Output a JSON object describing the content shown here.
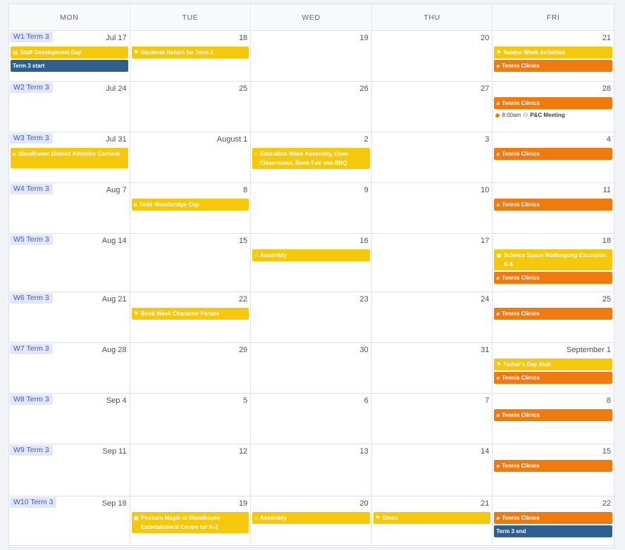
{
  "days_of_week": [
    "MON",
    "TUE",
    "WED",
    "THU",
    "FRI"
  ],
  "colors": {
    "yellow": "#f6c80c",
    "orange": "#f07a0d",
    "blue": "#2f5f8f",
    "week_label": "#e3e7fb"
  },
  "weeks": [
    {
      "label": "W1 Term 3",
      "days": [
        {
          "date": "Jul 17",
          "events": [
            {
              "title": "Staff Development Day",
              "color": "yellow",
              "icon": "clipboard-icon"
            },
            {
              "title": "Term 3 start",
              "color": "blue"
            }
          ]
        },
        {
          "date": "18",
          "events": [
            {
              "title": "Students Return for Term 3",
              "color": "yellow",
              "icon": "bell-icon"
            }
          ]
        },
        {
          "date": "19",
          "events": []
        },
        {
          "date": "20",
          "events": []
        },
        {
          "date": "21",
          "events": [
            {
              "title": "Naidoc Week Activities",
              "color": "yellow",
              "icon": "bell-icon"
            },
            {
              "title": "Tennis Clinics",
              "color": "orange",
              "icon": "racket-icon"
            }
          ]
        }
      ]
    },
    {
      "label": "W2 Term 3",
      "days": [
        {
          "date": "Jul 24",
          "events": []
        },
        {
          "date": "25",
          "events": []
        },
        {
          "date": "26",
          "events": []
        },
        {
          "date": "27",
          "events": []
        },
        {
          "date": "28",
          "events": [
            {
              "title": "Tennis Clinics",
              "color": "orange",
              "icon": "racket-icon"
            },
            {
              "time": "8:00am",
              "title": "P&C Meeting",
              "type": "timed",
              "icon": "people-icon"
            }
          ]
        }
      ]
    },
    {
      "label": "W3 Term 3",
      "days": [
        {
          "date": "Jul 31",
          "events": [
            {
              "title": "Shoalhaven District Athletics Carnival",
              "color": "yellow",
              "icon": "racket-icon",
              "tall": true
            }
          ]
        },
        {
          "date": "August 1",
          "events": []
        },
        {
          "date": "2",
          "events": [
            {
              "title": "Education Week Assembly, Open Classrooms, Book Fair and BBQ",
              "color": "yellow",
              "icon": "school-icon",
              "tall": true
            }
          ]
        },
        {
          "date": "3",
          "events": []
        },
        {
          "date": "4",
          "events": [
            {
              "title": "Tennis Clinics",
              "color": "orange",
              "icon": "racket-icon"
            }
          ]
        }
      ]
    },
    {
      "label": "W4 Term 3",
      "days": [
        {
          "date": "Aug 7",
          "events": []
        },
        {
          "date": "8",
          "events": [
            {
              "title": "Todd Woodbridge Cup",
              "color": "yellow",
              "icon": "racket-icon"
            }
          ]
        },
        {
          "date": "9",
          "events": []
        },
        {
          "date": "10",
          "events": []
        },
        {
          "date": "11",
          "events": [
            {
              "title": "Tennis Clinics",
              "color": "orange",
              "icon": "racket-icon"
            }
          ]
        }
      ]
    },
    {
      "label": "W5 Term 3",
      "days": [
        {
          "date": "Aug 14",
          "events": []
        },
        {
          "date": "15",
          "events": []
        },
        {
          "date": "16",
          "events": [
            {
              "title": "Assembly",
              "color": "yellow",
              "icon": "school-icon"
            }
          ]
        },
        {
          "date": "17",
          "events": []
        },
        {
          "date": "18",
          "events": [
            {
              "title": "Science Space Wollongong Excursion K-6",
              "color": "yellow",
              "icon": "bus-icon",
              "tall": true
            },
            {
              "title": "Tennis Clinics",
              "color": "orange",
              "icon": "racket-icon"
            }
          ]
        }
      ]
    },
    {
      "label": "W6 Term 3",
      "days": [
        {
          "date": "Aug 21",
          "events": []
        },
        {
          "date": "22",
          "events": [
            {
              "title": "Book Week Character Parade",
              "color": "yellow",
              "icon": "bell-icon"
            }
          ]
        },
        {
          "date": "23",
          "events": []
        },
        {
          "date": "24",
          "events": []
        },
        {
          "date": "25",
          "events": [
            {
              "title": "Tennis Clinics",
              "color": "orange",
              "icon": "racket-icon"
            }
          ]
        }
      ]
    },
    {
      "label": "W7 Term 3",
      "days": [
        {
          "date": "Aug 28",
          "events": []
        },
        {
          "date": "29",
          "events": []
        },
        {
          "date": "30",
          "events": []
        },
        {
          "date": "31",
          "events": []
        },
        {
          "date": "September 1",
          "events": [
            {
              "title": "Father's Day Stall",
              "color": "yellow",
              "icon": "bell-icon"
            },
            {
              "title": "Tennis Clinics",
              "color": "orange",
              "icon": "racket-icon"
            }
          ]
        }
      ]
    },
    {
      "label": "W8 Term 3",
      "days": [
        {
          "date": "Sep 4",
          "events": []
        },
        {
          "date": "5",
          "events": []
        },
        {
          "date": "6",
          "events": []
        },
        {
          "date": "7",
          "events": []
        },
        {
          "date": "8",
          "events": [
            {
              "title": "Tennis Clinics",
              "color": "orange",
              "icon": "racket-icon"
            }
          ]
        }
      ]
    },
    {
      "label": "W9 Term 3",
      "days": [
        {
          "date": "Sep 11",
          "events": []
        },
        {
          "date": "12",
          "events": []
        },
        {
          "date": "13",
          "events": []
        },
        {
          "date": "14",
          "events": []
        },
        {
          "date": "15",
          "events": [
            {
              "title": "Tennis Clinics",
              "color": "orange",
              "icon": "racket-icon"
            }
          ]
        }
      ]
    },
    {
      "label": "W10 Term 3",
      "days": [
        {
          "date": "Sep 18",
          "events": []
        },
        {
          "date": "19",
          "events": [
            {
              "title": "Possum Magic at Shoalhaven Entertainment Centre for K-2",
              "color": "yellow",
              "icon": "bus-icon",
              "tall": true
            }
          ]
        },
        {
          "date": "20",
          "events": [
            {
              "title": "Assembly",
              "color": "yellow",
              "icon": "school-icon"
            }
          ]
        },
        {
          "date": "21",
          "events": [
            {
              "title": "Disco",
              "color": "yellow",
              "icon": "bell-icon"
            }
          ]
        },
        {
          "date": "22",
          "events": [
            {
              "title": "Tennis Clinics",
              "color": "orange",
              "icon": "racket-icon"
            },
            {
              "title": "Term 3 end",
              "color": "blue"
            }
          ]
        }
      ]
    }
  ]
}
